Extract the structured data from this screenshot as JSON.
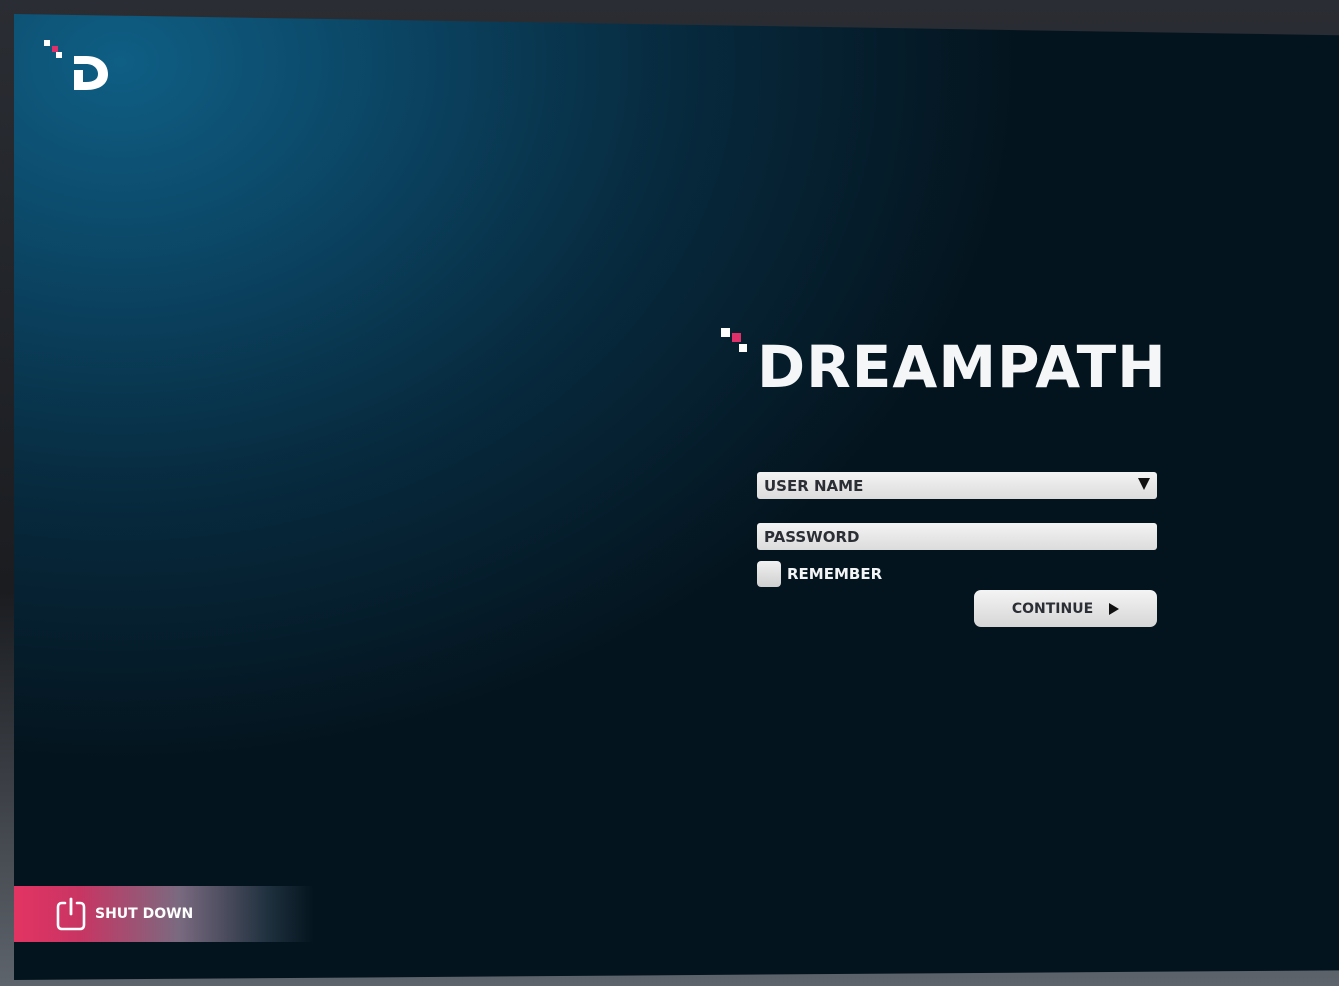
{
  "brand": {
    "name": "DREAMPATH",
    "accent_color": "#e0306a",
    "text_color": "#f4f6f8"
  },
  "login": {
    "username_placeholder": "USER NAME",
    "password_placeholder": "PASSWORD",
    "remember_label": "REMEMBER",
    "remember_checked": false,
    "continue_label": "CONTINUE"
  },
  "footer": {
    "shutdown_label": "SHUT DOWN",
    "shutdown_color": "#e33463"
  },
  "icons": {
    "corner_logo": "dreampath-d-logo-icon",
    "dropdown": "triangle-down-icon",
    "continue": "play-arrow-icon",
    "power": "power-icon"
  }
}
